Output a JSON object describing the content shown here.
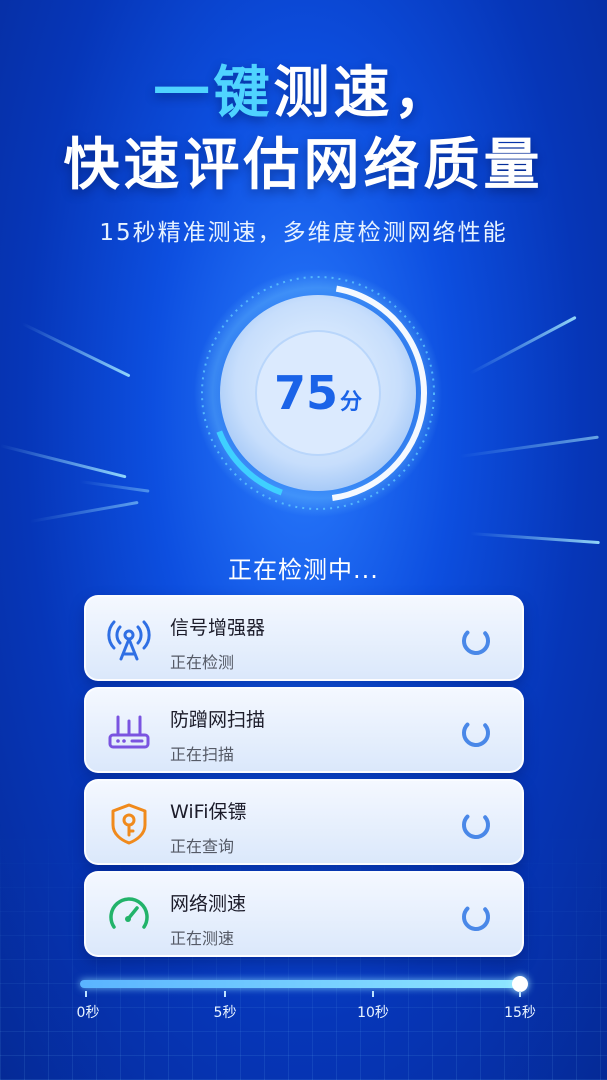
{
  "headline": {
    "line1_accent": "一键",
    "line1_rest": "测速，",
    "line2": "快速评估网络质量"
  },
  "subtitle": "15秒精准测速，多维度检测网络性能",
  "gauge": {
    "score": "75",
    "unit": "分"
  },
  "status_title": "正在检测中...",
  "items": [
    {
      "title": "信号增强器",
      "state": "正在检测",
      "icon": "signal-tower-icon"
    },
    {
      "title": "防蹭网扫描",
      "state": "正在扫描",
      "icon": "router-icon"
    },
    {
      "title": "WiFi保镖",
      "state": "正在查询",
      "icon": "shield-key-icon"
    },
    {
      "title": "网络测速",
      "state": "正在测速",
      "icon": "speedometer-icon"
    }
  ],
  "timeline": {
    "labels": [
      "0秒",
      "5秒",
      "10秒",
      "15秒"
    ],
    "progress": 1.0
  },
  "colors": {
    "accent": "#4fd3ff",
    "score": "#1a63e8",
    "background": "#0d4fe0"
  }
}
